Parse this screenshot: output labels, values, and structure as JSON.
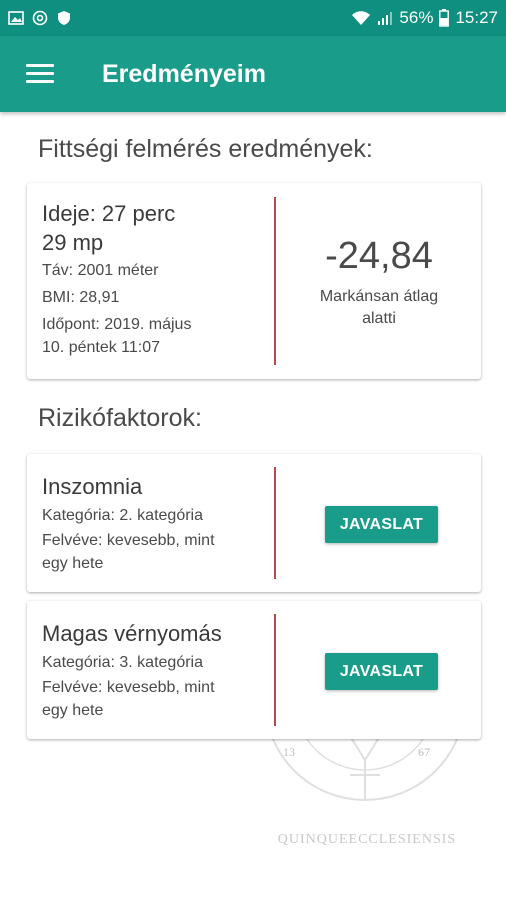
{
  "status_bar": {
    "battery": "56%",
    "time": "15:27",
    "icons": [
      "image-icon",
      "at-sign-icon",
      "shield-icon",
      "wifi-icon",
      "signal-icon",
      "battery-icon"
    ]
  },
  "app_bar": {
    "title": "Eredményeim",
    "menu_icon": "hamburger-menu-icon"
  },
  "fitness": {
    "section_title": "Fittségi felmérés eredmények:",
    "duration_line1": "Ideje: 27 perc",
    "duration_line2": "29 mp",
    "distance": "Táv: 2001 méter",
    "bmi": "BMI: 28,91",
    "date_line1": "Időpont: 2019. május",
    "date_line2": "10. péntek 11:07",
    "score": "-24,84",
    "score_desc_line1": "Markánsan átlag",
    "score_desc_line2": "alatti"
  },
  "risk": {
    "section_title": "Rizikófaktorok:",
    "items": [
      {
        "title": "Inszomnia",
        "category": "Kategória: 2. kategória",
        "recorded_line1": "Felvéve: kevesebb, mint",
        "recorded_line2": "egy hete",
        "button": "JAVASLAT"
      },
      {
        "title": "Magas vérnyomás",
        "category": "Kategória: 3. kategória",
        "recorded_line1": "Felvéve: kevesebb, mint",
        "recorded_line2": "egy hete",
        "button": "JAVASLAT"
      }
    ]
  },
  "watermark": {
    "text": "QUINQUEECCLESIENSIS",
    "left_number": "13",
    "right_number": "67"
  },
  "colors": {
    "status_bar": "#0e8f7f",
    "app_bar": "#1a9c8b",
    "button": "#1a9c8b",
    "divider": "#b24a4a"
  }
}
